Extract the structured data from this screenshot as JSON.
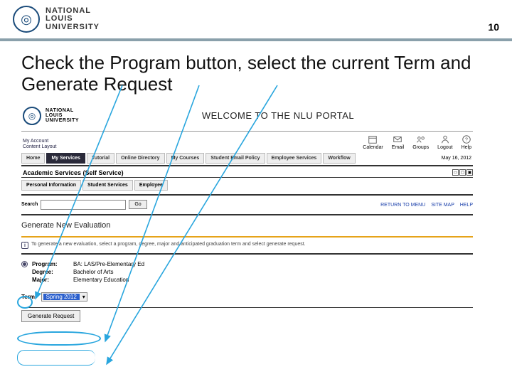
{
  "slide": {
    "page_number": "10",
    "university_name": "NATIONAL\nLOUIS\nUNIVERSITY",
    "instruction": "Check the Program button, select the current Term and Generate Request"
  },
  "portal": {
    "university_name_small": "NATIONAL\nLOUIS\nUNIVERSITY",
    "welcome": "WELCOME TO THE NLU PORTAL",
    "account_links": {
      "line1": "My Account",
      "line2": "Content Layout"
    },
    "utility": [
      {
        "label": "Calendar"
      },
      {
        "label": "Email"
      },
      {
        "label": "Groups"
      },
      {
        "label": "Logout"
      },
      {
        "label": "Help"
      }
    ],
    "nav": {
      "items": [
        "Home",
        "My Services",
        "Tutorial",
        "Online Directory",
        "My Courses",
        "Student Email Policy",
        "Employee Services",
        "Workflow"
      ],
      "active": "My Services",
      "date": "May 16, 2012"
    },
    "section_title": "Academic Services (Self Service)",
    "subnav": [
      "Personal Information",
      "Student Services",
      "Employee"
    ],
    "search": {
      "label": "Search",
      "go": "Go",
      "value": ""
    },
    "right_links": [
      "RETURN TO MENU",
      "SITE MAP",
      "HELP"
    ],
    "page_heading": "Generate New Evaluation",
    "info_text": "To generate a new evaluation, select a program, degree, major and anticipated graduation term and select generate request.",
    "fields": {
      "program": {
        "label": "Program:",
        "value": "BA: LAS/Pre-Elementary Ed",
        "checked": true
      },
      "degree": {
        "label": "Degree:",
        "value": "Bachelor of Arts"
      },
      "major": {
        "label": "Major:",
        "value": "Elementary Education"
      }
    },
    "term": {
      "label": "Term:",
      "selected": "Spring 2012"
    },
    "generate_button": "Generate Request"
  }
}
